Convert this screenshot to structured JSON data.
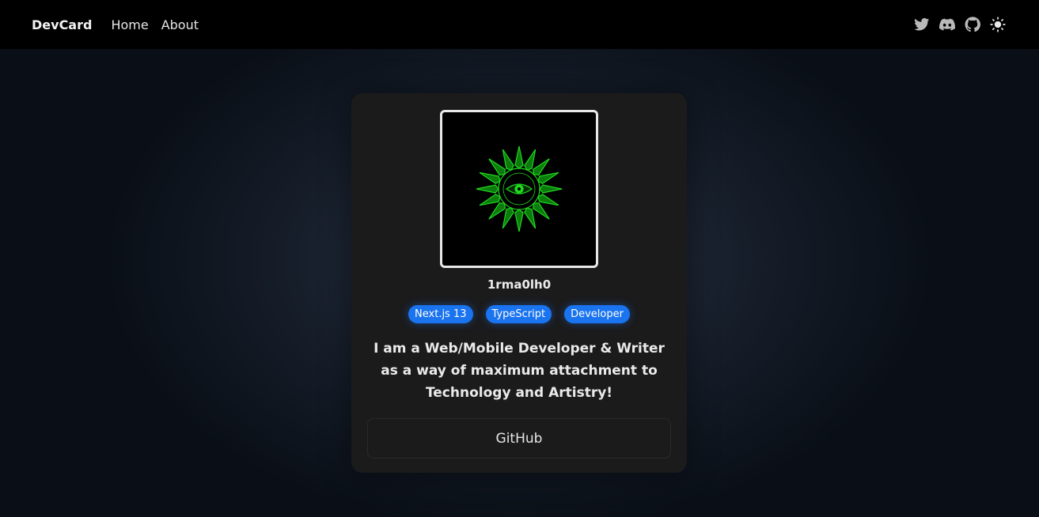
{
  "nav": {
    "brand": "DevCard",
    "links": [
      {
        "label": "Home"
      },
      {
        "label": "About"
      }
    ],
    "icons": [
      "twitter-icon",
      "discord-icon",
      "github-icon",
      "theme-toggle-sun-icon"
    ]
  },
  "profile": {
    "avatar_icon": "green-sun-eye-emblem",
    "username": "1rma0lh0",
    "tags": [
      "Next.js 13",
      "TypeScript",
      "Developer"
    ],
    "bio": "I am a Web/Mobile Developer & Writer as a way of maximum attachment to Technology and Artistry!",
    "github_label": "GitHub"
  },
  "colors": {
    "navbar_bg": "#000000",
    "card_bg": "#1b1b1c",
    "tag_bg": "#1a74f0",
    "accent_green": "#1fd81f"
  }
}
